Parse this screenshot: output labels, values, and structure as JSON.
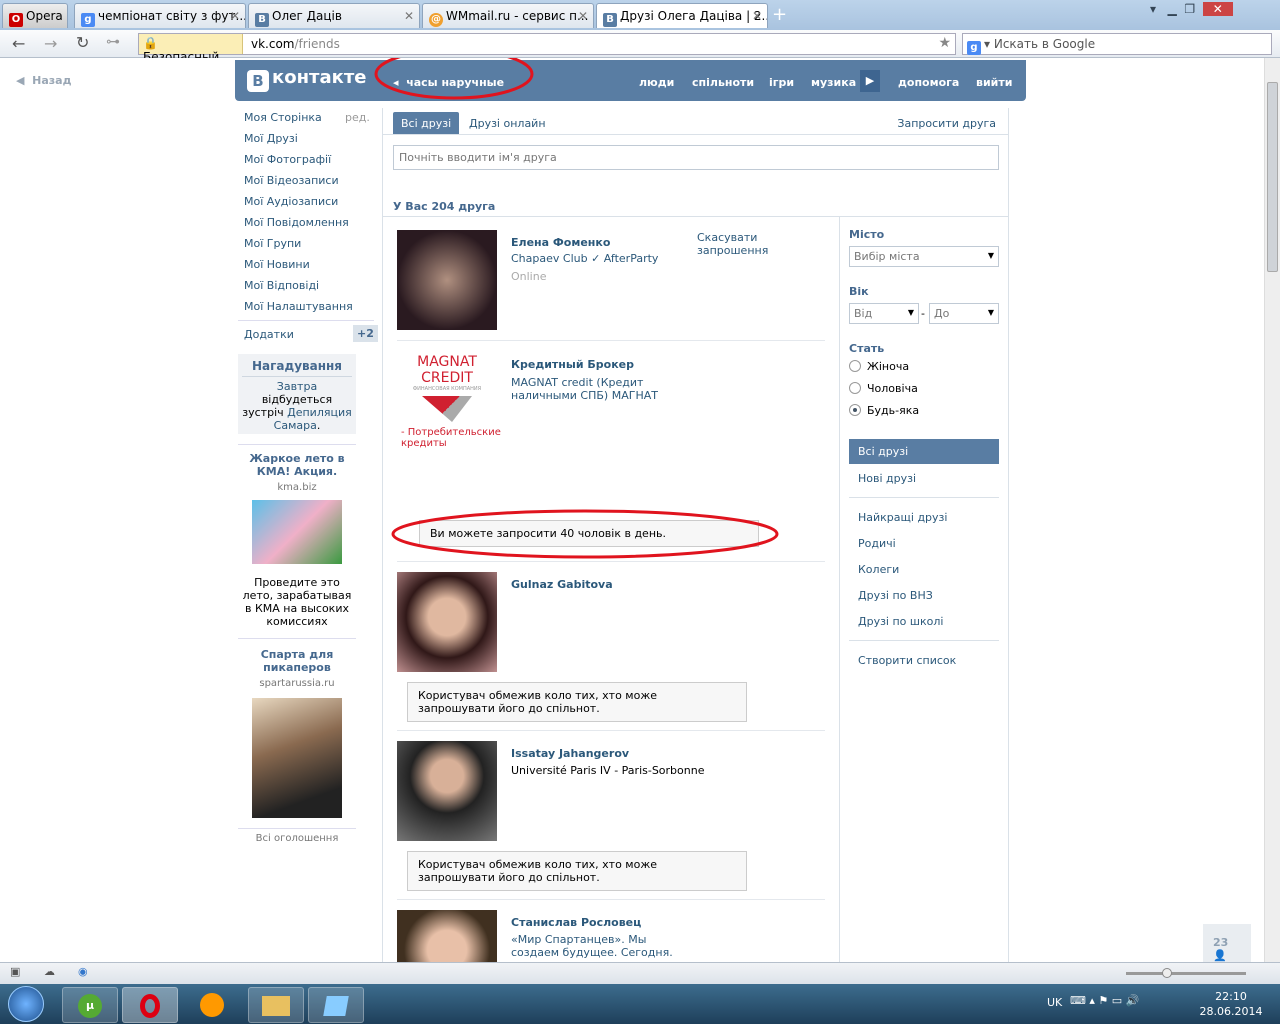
{
  "browser": {
    "opera_label": "Opera",
    "tabs": [
      {
        "title": "чемпіонат світу з фут..."
      },
      {
        "title": "Олег Даців"
      },
      {
        "title": "WMmail.ru - сервис п..."
      },
      {
        "title": "Друзі Олега Даціва | 2..."
      }
    ],
    "security": "Безопасный",
    "url_host": "vk.com",
    "url_path": "/friends",
    "search_placeholder": "Искать в Google",
    "back": "Назад"
  },
  "header": {
    "logo": "ВКонтакте",
    "logo_b": "В",
    "logo_text": "контакте",
    "ad_link": "часы наручные",
    "nav": [
      "люди",
      "спільноти",
      "ігри",
      "музика",
      "допомога",
      "вийти"
    ]
  },
  "left_menu": {
    "items": [
      "Моя Сторінка",
      "Мої Друзі",
      "Мої Фотографії",
      "Мої Відеозаписи",
      "Мої Аудіозаписи",
      "Мої Повідомлення",
      "Мої Групи",
      "Мої Новини",
      "Мої Відповіді",
      "Мої Налаштування"
    ],
    "edit": "ред.",
    "apps": "Додатки",
    "apps_badge": "+2",
    "reminder": {
      "title": "Нагадування",
      "when": "Завтра",
      "text": " відбудеться зустріч ",
      "event": "Депиляция Самара",
      "end": "."
    },
    "ads": [
      {
        "title": "Жаркое лето в КМА! Акция.",
        "domain": "kma.biz",
        "text": "Проведите это лето, зарабатывая в КМА на высоких комиссиях"
      },
      {
        "title": "Спарта для пикаперов",
        "domain": "spartarussia.ru"
      }
    ],
    "all_ads": "Всі оголошення"
  },
  "main": {
    "tabs": [
      "Всі друзі",
      "Друзі онлайн"
    ],
    "invite": "Запросити друга",
    "search_placeholder": "Почніть вводити ім'я друга",
    "count_text": "У Вас 204 друга",
    "friends": [
      {
        "name": "Елена Фоменко",
        "sub": "Chapaev Club ✓ AfterParty",
        "status": "Online",
        "action": "Скасувати запрошення"
      },
      {
        "name": "Кредитный Брокер",
        "sub": "MAGNAT credit (Кредит наличными СПБ) МАГНАТ",
        "logo": "MAGNAT CREDIT",
        "logo_sub": "ФИНАНСОВАЯ КОМПАНИЯ",
        "logo_caption": "- Потребительские кредиты",
        "note": "Ви можете запросити 40 чоловік в день."
      },
      {
        "name": "Gulnaz Gabitova",
        "note": "Користувач обмежив коло тих, хто може запрошувати його до спільнот."
      },
      {
        "name": "Issatay Jahangerov",
        "sub": "Université Paris IV - Paris-Sorbonne",
        "note": "Користувач обмежив коло тих, хто може запрошувати його до спільнот."
      },
      {
        "name": "Станислав Рословец",
        "sub": "«Мир Спартанцев». Мы создаем будущее. Сегодня."
      }
    ]
  },
  "filters": {
    "city_label": "Місто",
    "city_value": "Вибір міста",
    "age_label": "Вік",
    "age_from": "Від",
    "age_to": "До",
    "age_dash": "-",
    "sex_label": "Стать",
    "sex_options": [
      "Жіноча",
      "Чоловіча",
      "Будь-яка"
    ],
    "sex_selected": 2,
    "lists": [
      "Всі друзі",
      "Нові друзі",
      "Найкращі друзі",
      "Родичі",
      "Колеги",
      "Друзі по ВНЗ",
      "Друзі по школі",
      "Створити список"
    ]
  },
  "counter": "23",
  "taskbar": {
    "lang": "UK",
    "time": "22:10",
    "date": "28.06.2014"
  },
  "colors": {
    "vk_blue": "#597da3",
    "link": "#2b587a",
    "annotation": "#e0141e"
  }
}
